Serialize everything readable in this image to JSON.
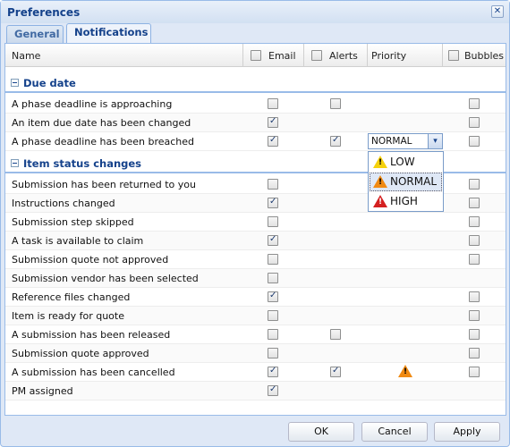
{
  "window": {
    "title": "Preferences"
  },
  "tabs": [
    {
      "label": "General",
      "active": false
    },
    {
      "label": "Notifications",
      "active": true
    }
  ],
  "columns": {
    "name": "Name",
    "email": "Email",
    "alerts": "Alerts",
    "priority": "Priority",
    "bubbles": "Bubbles"
  },
  "groups": [
    {
      "label": "Due date",
      "rows": [
        {
          "name": "A phase deadline is approaching",
          "email": "unchecked",
          "alerts": "unchecked",
          "priority": "",
          "bubbles": "unchecked"
        },
        {
          "name": "An item due date has been changed",
          "email": "checked",
          "alerts": "",
          "priority": "",
          "bubbles": "unchecked"
        },
        {
          "name": "A phase deadline has been breached",
          "email": "checked",
          "alerts": "checked",
          "priority": "NORMAL",
          "bubbles": "unchecked"
        }
      ]
    },
    {
      "label": "Item status changes",
      "rows": [
        {
          "name": "Submission has been returned to you",
          "email": "unchecked",
          "alerts": "",
          "priority": "",
          "bubbles": "unchecked"
        },
        {
          "name": "Instructions changed",
          "email": "checked",
          "alerts": "",
          "priority": "",
          "bubbles": "unchecked"
        },
        {
          "name": "Submission step skipped",
          "email": "unchecked",
          "alerts": "",
          "priority": "",
          "bubbles": "unchecked"
        },
        {
          "name": "A task is available to claim",
          "email": "checked",
          "alerts": "",
          "priority": "",
          "bubbles": "unchecked"
        },
        {
          "name": "Submission quote not approved",
          "email": "unchecked",
          "alerts": "",
          "priority": "",
          "bubbles": "unchecked"
        },
        {
          "name": "Submission vendor has been selected",
          "email": "unchecked",
          "alerts": "",
          "priority": "",
          "bubbles": ""
        },
        {
          "name": "Reference files changed",
          "email": "checked",
          "alerts": "",
          "priority": "",
          "bubbles": "unchecked"
        },
        {
          "name": "Item is ready for quote",
          "email": "unchecked",
          "alerts": "",
          "priority": "",
          "bubbles": "unchecked"
        },
        {
          "name": "A submission has been released",
          "email": "unchecked",
          "alerts": "unchecked",
          "priority": "",
          "bubbles": "unchecked"
        },
        {
          "name": "Submission quote approved",
          "email": "unchecked",
          "alerts": "",
          "priority": "",
          "bubbles": "unchecked"
        },
        {
          "name": "A submission has been cancelled",
          "email": "checked",
          "alerts": "checked",
          "priority": "warning",
          "bubbles": "unchecked"
        },
        {
          "name": "PM assigned",
          "email": "checked",
          "alerts": "",
          "priority": "",
          "bubbles": ""
        }
      ]
    }
  ],
  "priority_dropdown": {
    "selected": "NORMAL",
    "options": [
      {
        "label": "LOW",
        "color": "#f5d10c"
      },
      {
        "label": "NORMAL",
        "color": "#f08a12"
      },
      {
        "label": "HIGH",
        "color": "#d42020"
      }
    ]
  },
  "buttons": {
    "ok": "OK",
    "cancel": "Cancel",
    "apply": "Apply"
  },
  "colors": {
    "header_text": "#15428b",
    "frame": "#dfe8f6",
    "border": "#99bbe8"
  }
}
